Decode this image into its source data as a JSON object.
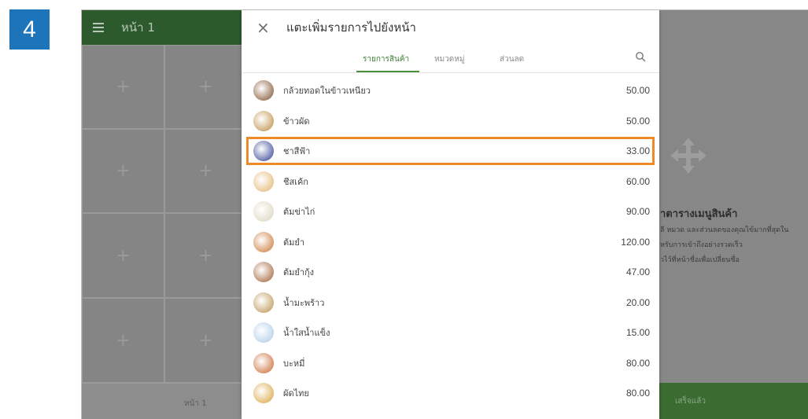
{
  "step": "4",
  "background": {
    "page_title": "หน้า 1",
    "bottom_tab": "หน้า 1",
    "hint": {
      "title": "าตารางเมนูสินค้า",
      "lines": [
        "ลี หมวด และส่วนลดของคุณไข้มากที่สุดใน",
        "หรับการเข้าถึงอย่างรวดเร็ว",
        "วไว้ที่หน้าชื่อเพื่อเปลี่ยนชื่อ"
      ]
    },
    "done_button": "เสร็จแล้ว"
  },
  "panel": {
    "title": "แตะเพิ่มรายการไปยังหน้า",
    "tabs": [
      "รายการสินค้า",
      "หมวดหมู่",
      "ส่วนลด"
    ],
    "active_tab": "รายการสินค้า",
    "items": [
      {
        "name": "กล้วยทอดในข้าวเหนียว",
        "price": "50.00",
        "color": "#7a4a25"
      },
      {
        "name": "ข้าวผัด",
        "price": "50.00",
        "color": "#b98a3e"
      },
      {
        "name": "ชาสีฟ้า",
        "price": "33.00",
        "color": "#2b3b8f",
        "selected": true
      },
      {
        "name": "ชีสเค้ก",
        "price": "60.00",
        "color": "#e2b36a"
      },
      {
        "name": "ต้มข่าไก่",
        "price": "90.00",
        "color": "#d9d2b8"
      },
      {
        "name": "ต้มยำ",
        "price": "120.00",
        "color": "#c9732c"
      },
      {
        "name": "ต้มยำกุ้ง",
        "price": "47.00",
        "color": "#9c5a2e"
      },
      {
        "name": "น้ำมะพร้าว",
        "price": "20.00",
        "color": "#b98e4a"
      },
      {
        "name": "น้ำใสน้ำแข็ง",
        "price": "15.00",
        "color": "#a9c9e6"
      },
      {
        "name": "บะหมี่",
        "price": "80.00",
        "color": "#c7642b"
      },
      {
        "name": "ผัดไทย",
        "price": "80.00",
        "color": "#d8a13a"
      }
    ]
  },
  "colors": {
    "highlight": "#ef8a2a",
    "accent": "#4a8f3c",
    "badge": "#1d74b8"
  }
}
